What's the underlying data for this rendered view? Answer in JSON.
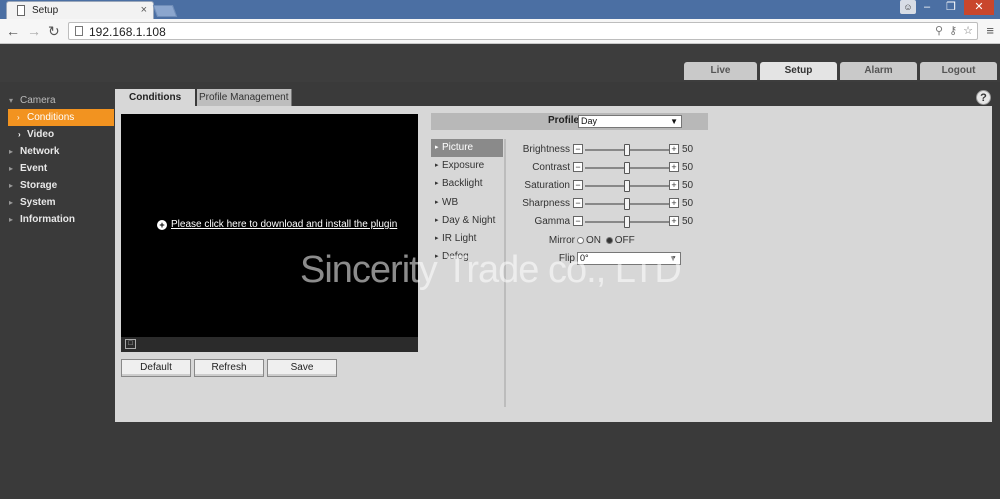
{
  "browser": {
    "tab_title": "Setup",
    "tab_close": "×",
    "url": "192.168.1.108",
    "window_controls": [
      "–",
      "❐",
      "✕"
    ]
  },
  "main_tabs": [
    {
      "label": "Live",
      "active": false
    },
    {
      "label": "Setup",
      "active": true
    },
    {
      "label": "Alarm",
      "active": false
    },
    {
      "label": "Logout",
      "active": false
    }
  ],
  "sidebar": {
    "items": [
      {
        "label": "Camera",
        "kind": "parent"
      },
      {
        "label": "Conditions",
        "kind": "active"
      },
      {
        "label": "Video",
        "kind": "sub"
      },
      {
        "label": "Network",
        "kind": "top"
      },
      {
        "label": "Event",
        "kind": "top"
      },
      {
        "label": "Storage",
        "kind": "top"
      },
      {
        "label": "System",
        "kind": "top"
      },
      {
        "label": "Information",
        "kind": "top"
      }
    ]
  },
  "sub_tabs": {
    "active": "Conditions",
    "other": "Profile Management"
  },
  "help_label": "?",
  "video": {
    "plugin_link": "Please click here to download and install the plugin"
  },
  "buttons": {
    "default": "Default",
    "refresh": "Refresh",
    "save": "Save"
  },
  "profile": {
    "label": "Profile",
    "value": "Day"
  },
  "left_menu": [
    {
      "label": "Picture",
      "active": true
    },
    {
      "label": "Exposure",
      "active": false
    },
    {
      "label": "Backlight",
      "active": false
    },
    {
      "label": "WB",
      "active": false
    },
    {
      "label": "Day & Night",
      "active": false
    },
    {
      "label": "IR Light",
      "active": false
    },
    {
      "label": "Defog",
      "active": false
    }
  ],
  "params": [
    {
      "label": "Brightness",
      "value": "50",
      "level": 0.5
    },
    {
      "label": "Contrast",
      "value": "50",
      "level": 0.5
    },
    {
      "label": "Saturation",
      "value": "50",
      "level": 0.5
    },
    {
      "label": "Sharpness",
      "value": "50",
      "level": 0.5
    },
    {
      "label": "Gamma",
      "value": "50",
      "level": 0.5
    }
  ],
  "mirror": {
    "label": "Mirror",
    "on": "ON",
    "off": "OFF",
    "selected": "off"
  },
  "flip": {
    "label": "Flip",
    "value": "0°"
  },
  "watermark": "Sincerity Trade co., LTD",
  "colors": {
    "accent": "#f29320",
    "panel": "#d7d7d7",
    "dark_bg": "#3a3a3a"
  }
}
